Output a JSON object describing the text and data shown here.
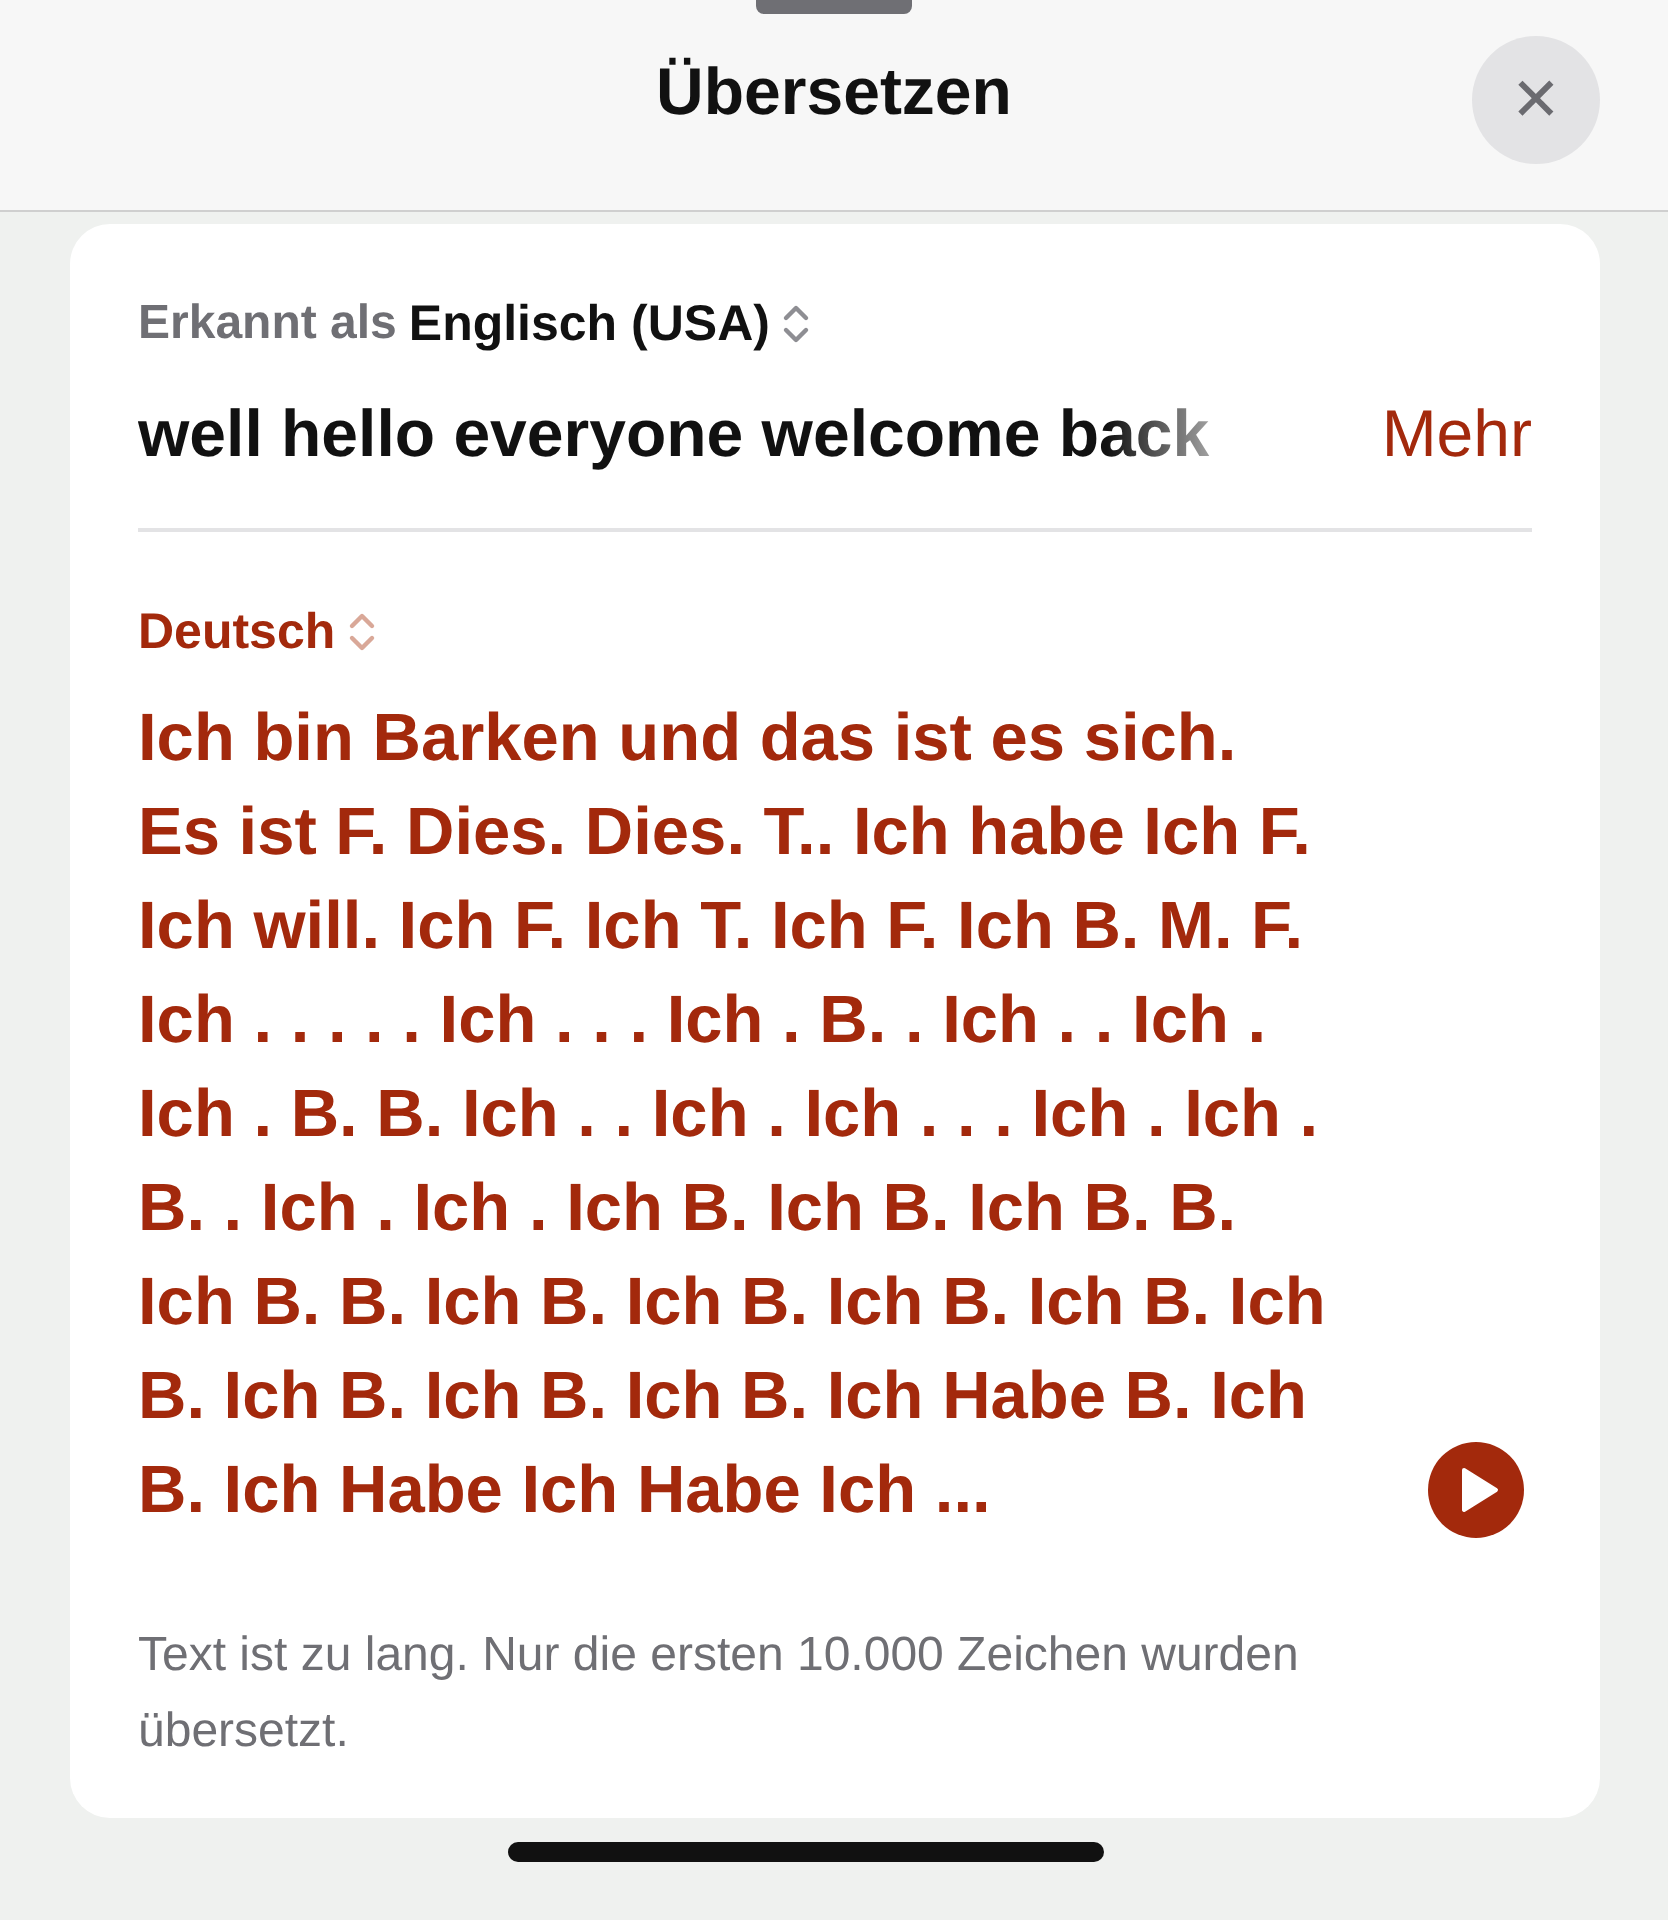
{
  "header": {
    "title": "Übersetzen",
    "close_label": "✕"
  },
  "source": {
    "detected_prefix": "Erkannt als",
    "language": "Englisch (USA)",
    "text": "well hello everyone welcome back",
    "more": "Mehr"
  },
  "target": {
    "language": "Deutsch",
    "lines": [
      "Ich bin Barken und das ist es sich.",
      "Es ist F. Dies. Dies. T.. Ich habe Ich F.",
      "Ich will. Ich F. Ich T. Ich F. Ich B. M. F.",
      "Ich . . . . . Ich . . . Ich . B. . Ich . . Ich .",
      "Ich . B. B. Ich . . Ich . Ich . . . Ich . Ich .",
      "B. . Ich . Ich . Ich B. Ich B. Ich B. B.",
      "Ich B. B. Ich B. Ich B. Ich B. Ich B. Ich",
      "B. Ich B. Ich B. Ich B. Ich Habe B. Ich",
      "B. Ich Habe Ich Habe Ich ..."
    ]
  },
  "notice": "Text ist zu lang. Nur die ersten 10.000 Zeichen wurden übersetzt."
}
